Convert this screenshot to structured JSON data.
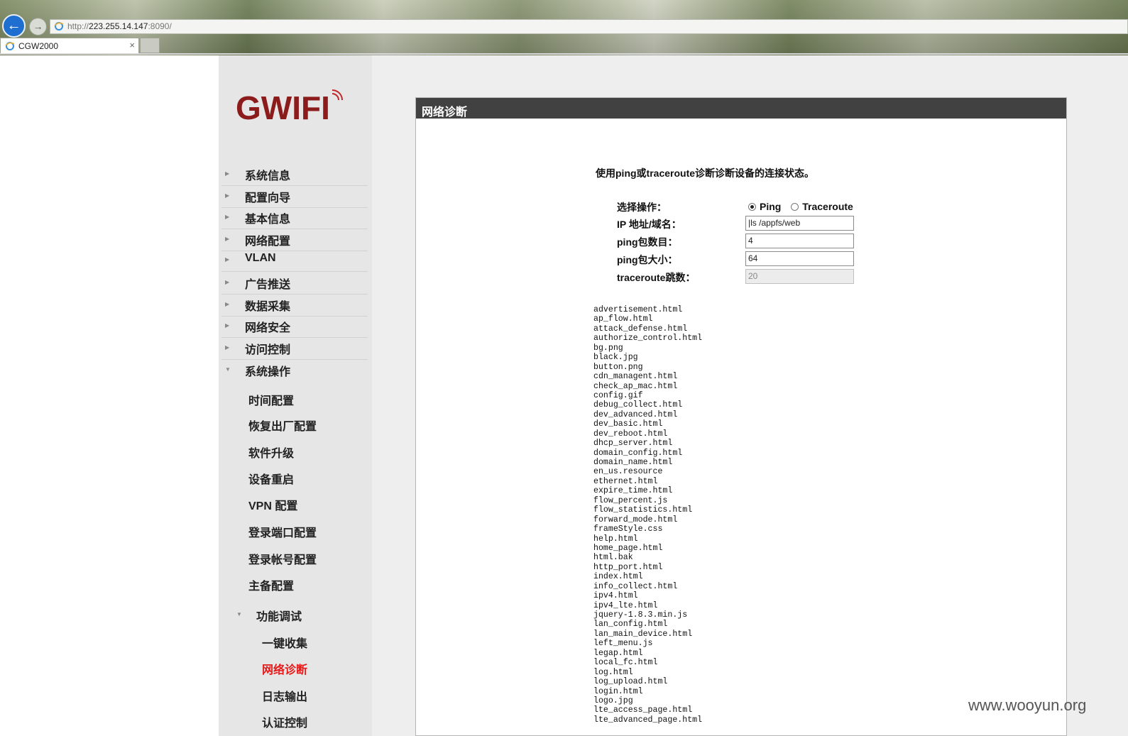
{
  "browser": {
    "url_prefix": "http://",
    "url_host": "223.255.14.147",
    "url_suffix": ":8090/",
    "tab_title": "CGW2000",
    "tab_close": "×"
  },
  "brand": {
    "logo_text": "GWIFI",
    "logo_color": "#8c1c1c"
  },
  "sidebar": {
    "menu": [
      {
        "label": "系统信息"
      },
      {
        "label": "配置向导"
      },
      {
        "label": "基本信息"
      },
      {
        "label": "网络配置"
      },
      {
        "label": "VLAN"
      },
      {
        "label": "广告推送"
      },
      {
        "label": "数据采集"
      },
      {
        "label": "网络安全"
      },
      {
        "label": "访问控制"
      },
      {
        "label": "系统操作"
      }
    ],
    "submenu": [
      {
        "label": "时间配置"
      },
      {
        "label": "恢复出厂配置"
      },
      {
        "label": "软件升级"
      },
      {
        "label": "设备重启"
      },
      {
        "label": "VPN 配置"
      },
      {
        "label": "登录端口配置"
      },
      {
        "label": "登录帐号配置"
      },
      {
        "label": "主备配置"
      }
    ],
    "debug_group": "功能调试",
    "debug_items": [
      {
        "label": "一键收集"
      },
      {
        "label": "网络诊断",
        "active": true
      },
      {
        "label": "日志输出"
      },
      {
        "label": "认证控制"
      }
    ]
  },
  "panel": {
    "title": "网络诊断",
    "description": "使用ping或traceroute诊断诊断设备的连接状态。",
    "operation_label": "选择操作：",
    "option_ping": "Ping",
    "option_traceroute": "Traceroute",
    "selected_option": "Ping",
    "ip_label": "IP 地址/域名：",
    "ip_value": "|ls /appfs/web",
    "count_label": "ping包数目：",
    "count_value": "4",
    "size_label": "ping包大小：",
    "size_value": "64",
    "hops_label": "traceroute跳数：",
    "hops_value": "20"
  },
  "listing": [
    "advertisement.html",
    "ap_flow.html",
    "attack_defense.html",
    "authorize_control.html",
    "bg.png",
    "black.jpg",
    "button.png",
    "cdn_managent.html",
    "check_ap_mac.html",
    "config.gif",
    "debug_collect.html",
    "dev_advanced.html",
    "dev_basic.html",
    "dev_reboot.html",
    "dhcp_server.html",
    "domain_config.html",
    "domain_name.html",
    "en_us.resource",
    "ethernet.html",
    "expire_time.html",
    "flow_percent.js",
    "flow_statistics.html",
    "forward_mode.html",
    "frameStyle.css",
    "help.html",
    "home_page.html",
    "html.bak",
    "http_port.html",
    "index.html",
    "info_collect.html",
    "ipv4.html",
    "ipv4_lte.html",
    "jquery-1.8.3.min.js",
    "lan_config.html",
    "lan_main_device.html",
    "left_menu.js",
    "legap.html",
    "local_fc.html",
    "log.html",
    "log_upload.html",
    "login.html",
    "logo.jpg",
    "lte_access_page.html",
    "lte_advanced_page.html"
  ],
  "watermark": "www.wooyun.org",
  "colors": {
    "accent_red": "#e31b1b",
    "header_dark": "#414141",
    "sidebar_bg": "#e6e6e6"
  }
}
